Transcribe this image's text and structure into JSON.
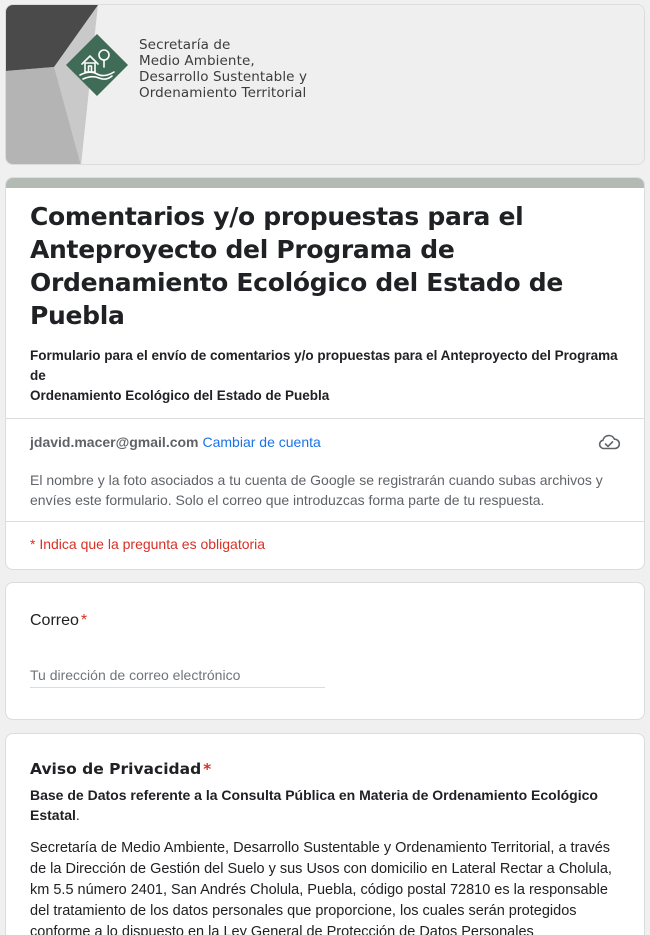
{
  "header": {
    "org_lines": [
      "Secretaría de",
      "Medio Ambiente,",
      "Desarrollo Sustentable y",
      "Ordenamiento Territorial"
    ],
    "logo_icon": "house-tree-landscape-icon",
    "logo_color": "#3f6b57"
  },
  "form": {
    "title": "Comentarios y/o propuestas para el Anteproyecto del Programa de Ordenamiento Ecológico del Estado de Puebla",
    "description_lines": [
      "Formulario para el envío de comentarios y/o propuestas para el Anteproyecto del Programa de",
      "Ordenamiento Ecológico del Estado de Puebla"
    ],
    "accent_color": "#b3bab4"
  },
  "account": {
    "email": "jdavid.macer@gmail.com",
    "switch_label": "Cambiar de cuenta",
    "status_icon": "cloud-check-icon",
    "notice": "El nombre y la foto asociados a tu cuenta de Google se registrarán cuando subas archivos y envíes este formulario. Solo el correo que introduzcas forma parte de tu respuesta."
  },
  "required_note": "* Indica que la pregunta es obligatoria",
  "email_question": {
    "label": "Correo",
    "required_mark": "*",
    "placeholder": "Tu dirección de correo electrónico",
    "value": ""
  },
  "privacy_question": {
    "label": "Aviso de Privacidad",
    "required_mark": "*",
    "subtitle": "Base de Datos referente a la Consulta Pública en Materia de Ordenamiento Ecológico Estatal",
    "subtitle_suffix": ".",
    "body": "Secretaría de Medio Ambiente, Desarrollo Sustentable y Ordenamiento Territorial, a través de la Dirección de Gestión del Suelo y sus Usos con domicilio en Lateral Rectar a Cholula, km 5.5 número 2401, San Andrés Cholula, Puebla, código postal 72810 es la responsable del tratamiento de los datos personales que proporcione, los cuales serán protegidos conforme a lo dispuesto en la Ley General de Protección de Datos Personales"
  }
}
